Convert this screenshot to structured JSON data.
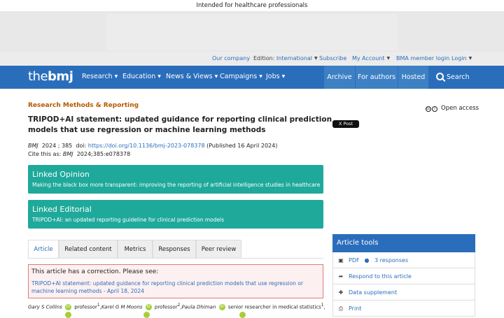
{
  "banner": {
    "text": "Intended for healthcare professionals"
  },
  "utility": {
    "our_company": "Our company",
    "edition_label": "Edition:",
    "edition_value": "International",
    "subscribe": "Subscribe",
    "my_account": "My Account",
    "bma_login": "BMA member login",
    "login": "Login"
  },
  "nav": {
    "logo_the": "the",
    "logo_bmj": "bmj",
    "items": [
      "Research",
      "Education",
      "News & Views",
      "Campaigns",
      "Jobs"
    ],
    "archive": "Archive",
    "for_authors": "For authors",
    "hosted": "Hosted",
    "search": "Search"
  },
  "article": {
    "section": "Research Methods & Reporting",
    "open_access": "Open access",
    "title": "TRIPOD+AI statement: updated guidance for reporting clinical prediction models that use regression or machine learning methods",
    "x_post": "X Post",
    "journal": "BMJ",
    "year_vol": "2024 ; 385",
    "doi_label": "doi:",
    "doi": "https://doi.org/10.1136/bmj-2023-078378",
    "published": "(Published 16 April 2024)",
    "cite_label": "Cite this as:",
    "cite_rest": "2024;385:e078378"
  },
  "linked_opinion": {
    "heading": "Linked Opinion",
    "text": "Making the black box more transparent: improving the reporting of artificial intelligence studies in healthcare"
  },
  "linked_editorial": {
    "heading": "Linked Editorial",
    "text": "TRIPOD+AI: an updated reporting guideline for clinical prediction models"
  },
  "tabs": [
    "Article",
    "Related content",
    "Metrics",
    "Responses",
    "Peer review"
  ],
  "correction": {
    "heading": "This article has a correction. Please see:",
    "link": "TRIPOD+AI statement: updated guidance for reporting clinical prediction models that use regression or machine learning methods - April 18, 2024"
  },
  "authors": {
    "a1": "Gary S Collins",
    "a1_role": "professor",
    "a1_sup": "1",
    "a2": "Karel G M Moons",
    "a2_role": "professor",
    "a2_sup": "2",
    "a3": "Paula Dhiman",
    "a3_role": "senior researcher in medical statistics",
    "a3_sup": "1"
  },
  "tools": {
    "header": "Article tools",
    "pdf": "PDF",
    "responses": "3 responses",
    "respond": "Respond to this article",
    "data_supplement": "Data supplement",
    "print": "Print"
  },
  "colors": {
    "brand_blue": "#2a6ebb",
    "teal": "#1fa99b",
    "section_orange": "#b35900"
  }
}
